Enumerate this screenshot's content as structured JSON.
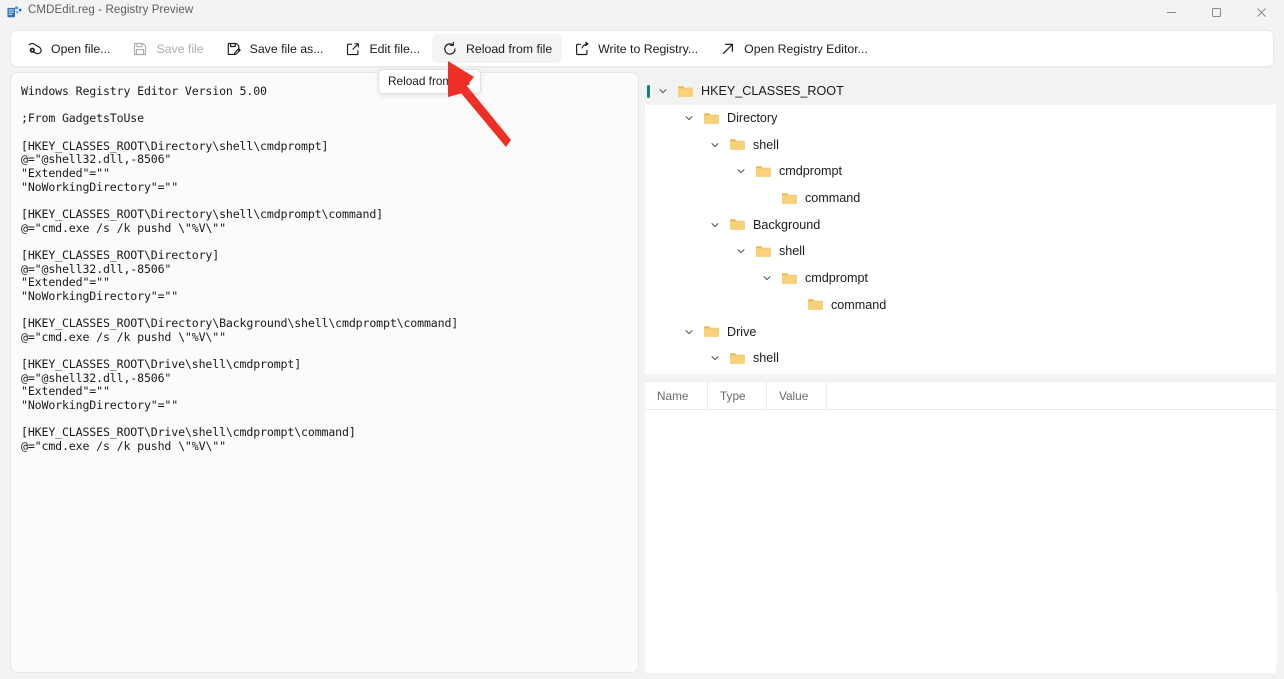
{
  "window": {
    "title": "CMDEdit.reg - Registry Preview",
    "app_icon": "registry-preview-icon",
    "controls": {
      "minimize": "minimize-icon",
      "maximize": "maximize-icon",
      "close": "close-icon"
    }
  },
  "toolbar": {
    "buttons": [
      {
        "label": "Open file...",
        "icon": "open-file-icon",
        "disabled": false,
        "hovered": false
      },
      {
        "label": "Save file",
        "icon": "save-file-icon",
        "disabled": true,
        "hovered": false
      },
      {
        "label": "Save file as...",
        "icon": "save-file-as-icon",
        "disabled": false,
        "hovered": false
      },
      {
        "label": "Edit file...",
        "icon": "edit-file-icon",
        "disabled": false,
        "hovered": false
      },
      {
        "label": "Reload from file",
        "icon": "reload-icon",
        "disabled": false,
        "hovered": true
      },
      {
        "label": "Write to Registry...",
        "icon": "write-to-registry-icon",
        "disabled": false,
        "hovered": false
      },
      {
        "label": "Open Registry Editor...",
        "icon": "open-registry-editor-icon",
        "disabled": false,
        "hovered": false
      }
    ]
  },
  "tooltip": {
    "text": "Reload from file"
  },
  "editor": {
    "content": "Windows Registry Editor Version 5.00\n\n;From GadgetsToUse\n\n[HKEY_CLASSES_ROOT\\Directory\\shell\\cmdprompt]\n@=\"@shell32.dll,-8506\"\n\"Extended\"=\"\"\n\"NoWorkingDirectory\"=\"\"\n\n[HKEY_CLASSES_ROOT\\Directory\\shell\\cmdprompt\\command]\n@=\"cmd.exe /s /k pushd \\\"%V\\\"\"\n\n[HKEY_CLASSES_ROOT\\Directory]\n@=\"@shell32.dll,-8506\"\n\"Extended\"=\"\"\n\"NoWorkingDirectory\"=\"\"\n\n[HKEY_CLASSES_ROOT\\Directory\\Background\\shell\\cmdprompt\\command]\n@=\"cmd.exe /s /k pushd \\\"%V\\\"\"\n\n[HKEY_CLASSES_ROOT\\Drive\\shell\\cmdprompt]\n@=\"@shell32.dll,-8506\"\n\"Extended\"=\"\"\n\"NoWorkingDirectory\"=\"\"\n\n[HKEY_CLASSES_ROOT\\Drive\\shell\\cmdprompt\\command]\n@=\"cmd.exe /s /k pushd \\\"%V\\\"\""
  },
  "tree": {
    "nodes": [
      {
        "label": "HKEY_CLASSES_ROOT",
        "depth": 0,
        "expanded": true,
        "selected": true,
        "has_children": true
      },
      {
        "label": "Directory",
        "depth": 1,
        "expanded": true,
        "selected": false,
        "has_children": true
      },
      {
        "label": "shell",
        "depth": 2,
        "expanded": true,
        "selected": false,
        "has_children": true
      },
      {
        "label": "cmdprompt",
        "depth": 3,
        "expanded": true,
        "selected": false,
        "has_children": true
      },
      {
        "label": "command",
        "depth": 4,
        "expanded": false,
        "selected": false,
        "has_children": false
      },
      {
        "label": "Background",
        "depth": 2,
        "expanded": true,
        "selected": false,
        "has_children": true
      },
      {
        "label": "shell",
        "depth": 3,
        "expanded": true,
        "selected": false,
        "has_children": true
      },
      {
        "label": "cmdprompt",
        "depth": 4,
        "expanded": true,
        "selected": false,
        "has_children": true
      },
      {
        "label": "command",
        "depth": 5,
        "expanded": false,
        "selected": false,
        "has_children": false
      },
      {
        "label": "Drive",
        "depth": 1,
        "expanded": true,
        "selected": false,
        "has_children": true
      },
      {
        "label": "shell",
        "depth": 2,
        "expanded": true,
        "selected": false,
        "has_children": true
      }
    ]
  },
  "value_table": {
    "columns": [
      "Name",
      "Type",
      "Value"
    ],
    "rows": []
  },
  "annotation": {
    "arrow_color": "#ed2f25",
    "arrow_name": "red-pointer-arrow"
  },
  "colors": {
    "selection_accent": "#12836f",
    "folder": "#f7cf6b",
    "window_bg": "#f3f3f3"
  }
}
